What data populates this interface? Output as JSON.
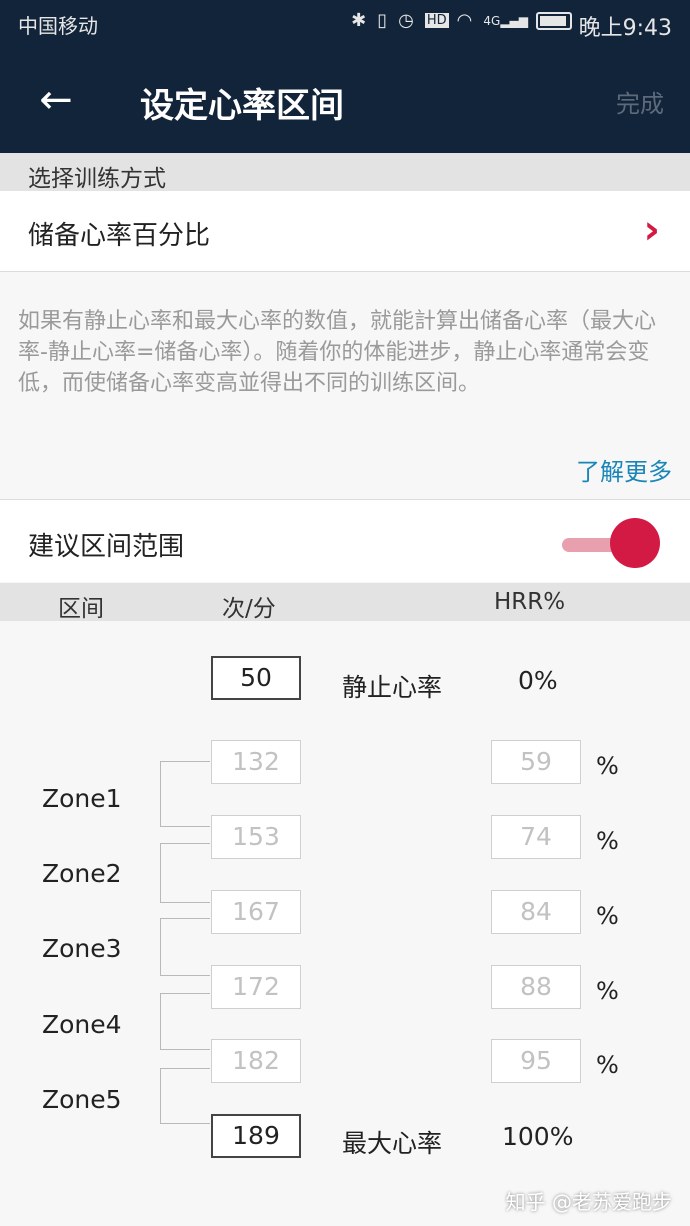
{
  "status_bar": {
    "carrier": "中国移动",
    "icons": [
      "bluetooth-icon",
      "vibrate-icon",
      "alarm-icon",
      "hd-icon",
      "wifi-icon",
      "signal-4g-icon",
      "battery-icon"
    ],
    "hd": "HD",
    "network": "4G",
    "time": "晚上9:43"
  },
  "app_bar": {
    "title": "设定心率区间",
    "done_label": "完成",
    "back_icon": "←"
  },
  "training_mode": {
    "header": "选择训练方式",
    "selected": "储备心率百分比",
    "chevron": "›"
  },
  "description": "如果有静止心率和最大心率的数值，就能計算出储备心率（最大心率-静止心率=储备心率）。随着你的体能进步，静止心率通常会变低，而使储备心率变高並得出不同的训练区间。",
  "learn_more": "了解更多",
  "suggested_range": {
    "label": "建议区间范围",
    "enabled": true
  },
  "table_header": {
    "zone": "区间",
    "bpm": "次/分",
    "hrr": "HRR%"
  },
  "resting": {
    "bpm": "50",
    "label": "静止心率",
    "percent": "0%"
  },
  "max": {
    "bpm": "189",
    "label": "最大心率",
    "percent": "100%"
  },
  "boundaries": [
    {
      "bpm": "132",
      "percent": "59",
      "unit": "%"
    },
    {
      "bpm": "153",
      "percent": "74",
      "unit": "%"
    },
    {
      "bpm": "167",
      "percent": "84",
      "unit": "%"
    },
    {
      "bpm": "172",
      "percent": "88",
      "unit": "%"
    },
    {
      "bpm": "182",
      "percent": "95",
      "unit": "%"
    }
  ],
  "zones": [
    "Zone1",
    "Zone2",
    "Zone3",
    "Zone4",
    "Zone5"
  ],
  "watermark": "知乎 @老苏爱跑步",
  "colors": {
    "app_bar": "#12243a",
    "accent_red": "#d21a44",
    "link_blue": "#1a86b7"
  }
}
